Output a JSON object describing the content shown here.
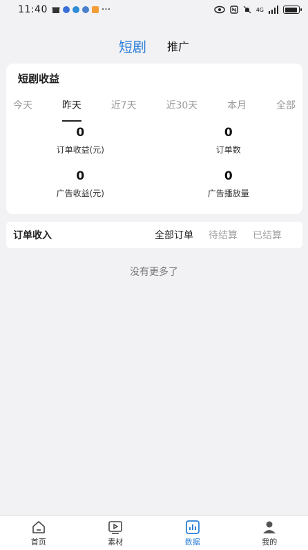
{
  "status_bar": {
    "time": "11:40",
    "more_indicator": "···",
    "signal_text": "4G",
    "battery_level": 0.9
  },
  "top_tabs": [
    {
      "label": "短剧",
      "active": true
    },
    {
      "label": "推广",
      "active": false
    }
  ],
  "income_card": {
    "title": "短剧收益",
    "periods": [
      {
        "label": "今天",
        "active": false
      },
      {
        "label": "昨天",
        "active": true
      },
      {
        "label": "近7天",
        "active": false
      },
      {
        "label": "近30天",
        "active": false
      },
      {
        "label": "本月",
        "active": false
      },
      {
        "label": "全部",
        "active": false
      }
    ],
    "stats": [
      {
        "value": "0",
        "label": "订单收益(元)"
      },
      {
        "value": "0",
        "label": "订单数"
      },
      {
        "value": "0",
        "label": "广告收益(元)"
      },
      {
        "value": "0",
        "label": "广告播放量"
      }
    ]
  },
  "orders": {
    "title": "订单收入",
    "filters": [
      {
        "label": "全部订单",
        "active": true
      },
      {
        "label": "待结算",
        "active": false
      },
      {
        "label": "已结算",
        "active": false
      }
    ],
    "empty_text": "没有更多了"
  },
  "bottom_nav": [
    {
      "label": "首页",
      "icon": "home-icon",
      "active": false
    },
    {
      "label": "素材",
      "icon": "play-icon",
      "active": false
    },
    {
      "label": "数据",
      "icon": "chart-icon",
      "active": true
    },
    {
      "label": "我的",
      "icon": "user-icon",
      "active": false
    }
  ],
  "colors": {
    "accent": "#2d7fd8",
    "background": "#f2f2f4"
  }
}
